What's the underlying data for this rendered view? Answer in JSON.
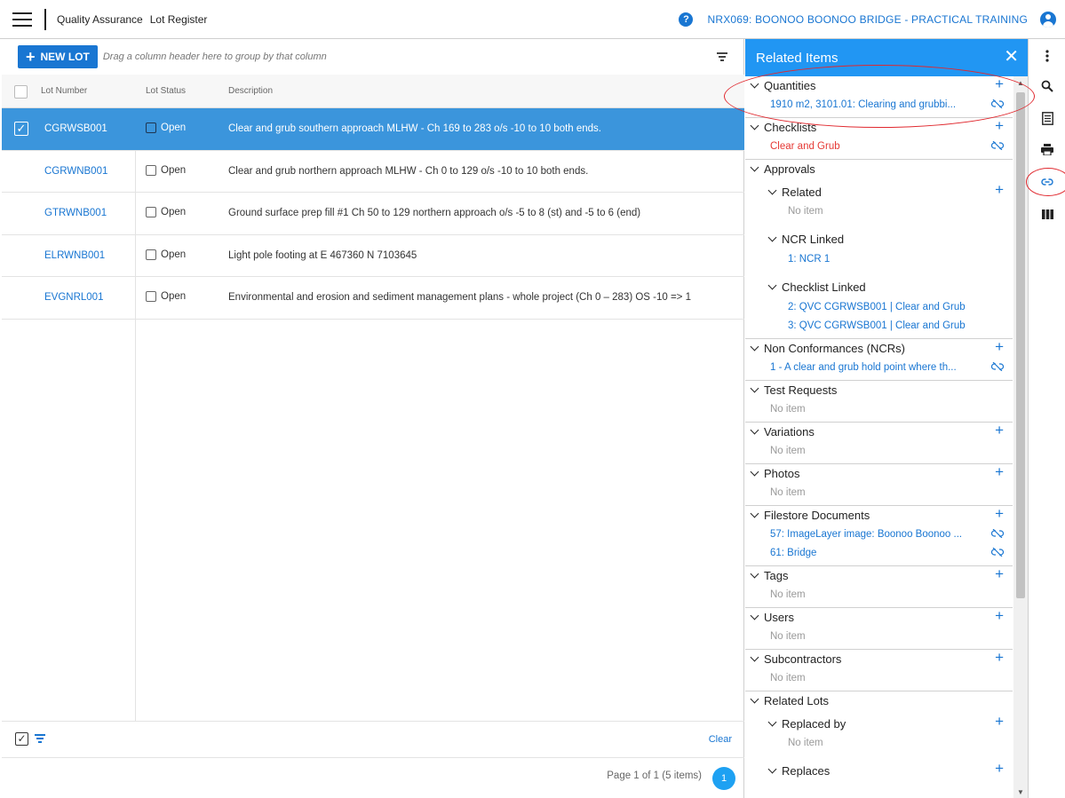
{
  "header": {
    "breadcrumb_1": "Quality Assurance",
    "breadcrumb_2": "Lot Register",
    "project": "NRX069: BOONOO BOONOO BRIDGE - PRACTICAL TRAINING",
    "help_glyph": "?"
  },
  "toolbar": {
    "new_lot_label": "NEW LOT",
    "group_hint": "Drag a column header here to group by that column"
  },
  "table": {
    "columns": [
      "Lot Number",
      "Lot Status",
      "Description"
    ],
    "rows": [
      {
        "lot": "CGRWSB001",
        "status": "Open",
        "description": "Clear and grub southern approach MLHW - Ch 169 to 283 o/s -10 to 10 both ends.",
        "selected": true
      },
      {
        "lot": "CGRWNB001",
        "status": "Open",
        "description": "Clear and grub northern approach MLHW - Ch 0 to 129 o/s -10 to 10 both ends.",
        "selected": false
      },
      {
        "lot": "GTRWNB001",
        "status": "Open",
        "description": "Ground surface prep fill #1 Ch 50 to 129 northern approach o/s -5 to 8 (st) and -5 to 6 (end)",
        "selected": false
      },
      {
        "lot": "ELRWNB001",
        "status": "Open",
        "description": "Light pole footing at E 467360 N 7103645",
        "selected": false
      },
      {
        "lot": "EVGNRL001",
        "status": "Open",
        "description": "Environmental and erosion and sediment management plans - whole project (Ch 0 – 283) OS -10 => 1",
        "selected": false
      }
    ]
  },
  "footer": {
    "clear_label": "Clear",
    "pager_text": "Page 1 of 1 (5 items)",
    "page_number": "1"
  },
  "panel": {
    "title": "Related Items",
    "no_item": "No item",
    "sections": {
      "quantities": {
        "title": "Quantities",
        "items": [
          "1910 m2, 3101.01: Clearing and grubbi..."
        ]
      },
      "checklists": {
        "title": "Checklists",
        "items": [
          "Clear and Grub"
        ]
      },
      "approvals": {
        "title": "Approvals",
        "related": {
          "title": "Related"
        },
        "ncr_linked": {
          "title": "NCR Linked",
          "items": [
            "1: NCR 1"
          ]
        },
        "checklist_linked": {
          "title": "Checklist Linked",
          "items": [
            "2: QVC CGRWSB001 | Clear and Grub",
            "3: QVC CGRWSB001 | Clear and Grub"
          ]
        }
      },
      "ncrs": {
        "title": "Non Conformances (NCRs)",
        "items": [
          "1 - A clear and grub hold point where th..."
        ]
      },
      "test_requests": {
        "title": "Test Requests"
      },
      "variations": {
        "title": "Variations"
      },
      "photos": {
        "title": "Photos"
      },
      "filestore": {
        "title": "Filestore Documents",
        "items": [
          "57: ImageLayer image: Boonoo Boonoo ...",
          "61: Bridge"
        ]
      },
      "tags": {
        "title": "Tags"
      },
      "users": {
        "title": "Users"
      },
      "subcontractors": {
        "title": "Subcontractors"
      },
      "related_lots": {
        "title": "Related Lots",
        "replaced_by": {
          "title": "Replaced by"
        },
        "replaces": {
          "title": "Replaces"
        }
      }
    }
  },
  "colors": {
    "accent": "#1976d2",
    "panel_header": "#2196f3",
    "selected_row": "#3b95dc",
    "warning_text": "#e53935",
    "annotation": "#e0282e"
  },
  "icons": {
    "rail": [
      "more-vertical-icon",
      "search-icon",
      "list-icon",
      "print-icon",
      "link-icon",
      "columns-icon"
    ]
  }
}
